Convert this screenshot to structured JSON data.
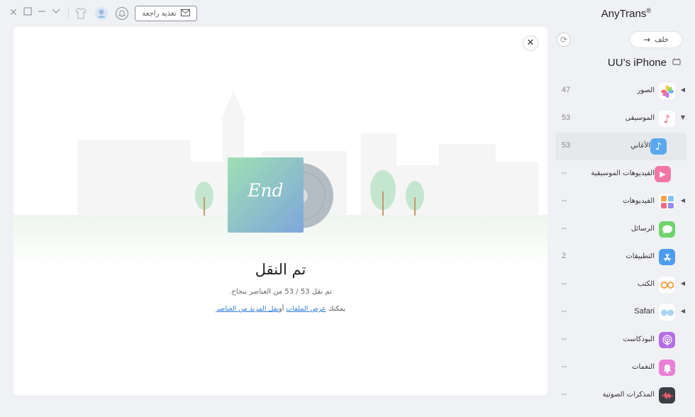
{
  "window": {
    "brand": "AnyTrans",
    "brand_mark": "®",
    "feedback_label": "تغذية راجعة"
  },
  "colors": {
    "accent_blue": "#2b7bd6",
    "panel_bg": "#ffffff",
    "app_bg": "#f0f1f4"
  },
  "main": {
    "close_icon": "close-icon",
    "cover_text": "End",
    "title": "تم النقل",
    "subtitle": "تم نقل 53 / 53 من العناصر بنجاح.",
    "links_prefix": "يمكنك",
    "view_files_link": "عرض الملفات",
    "links_or": "أو",
    "transfer_more_link": "نقل المزيد من العناصر"
  },
  "sidebar": {
    "back_label": "خلف",
    "device_name": "UU’s iPhone",
    "items": [
      {
        "label": "الصور",
        "count": "47",
        "icon": "photos-icon",
        "caret": "◀"
      },
      {
        "label": "الموسيقى",
        "count": "53",
        "icon": "music-icon",
        "caret": "▼"
      },
      {
        "label": "الأغاني",
        "count": "53",
        "icon": "songs-icon",
        "caret": ""
      },
      {
        "label": "الفيديوهات الموسيقية",
        "count": "--",
        "icon": "music-video-icon",
        "caret": ""
      },
      {
        "label": "الفيديوهات",
        "count": "--",
        "icon": "videos-icon",
        "caret": "◀"
      },
      {
        "label": "الرسائل",
        "count": "--",
        "icon": "messages-icon",
        "caret": ""
      },
      {
        "label": "التطبيقات",
        "count": "2",
        "icon": "app-store-icon",
        "caret": ""
      },
      {
        "label": "الكتب",
        "count": "--",
        "icon": "books-icon",
        "caret": "◀"
      },
      {
        "label": "Safari",
        "count": "--",
        "icon": "safari-icon",
        "caret": "◀"
      },
      {
        "label": "البودكاست",
        "count": "--",
        "icon": "podcasts-icon",
        "caret": ""
      },
      {
        "label": "النغمات",
        "count": "--",
        "icon": "ringtones-icon",
        "caret": ""
      },
      {
        "label": "المذكرات الصوتية",
        "count": "--",
        "icon": "voice-memos-icon",
        "caret": ""
      }
    ]
  }
}
